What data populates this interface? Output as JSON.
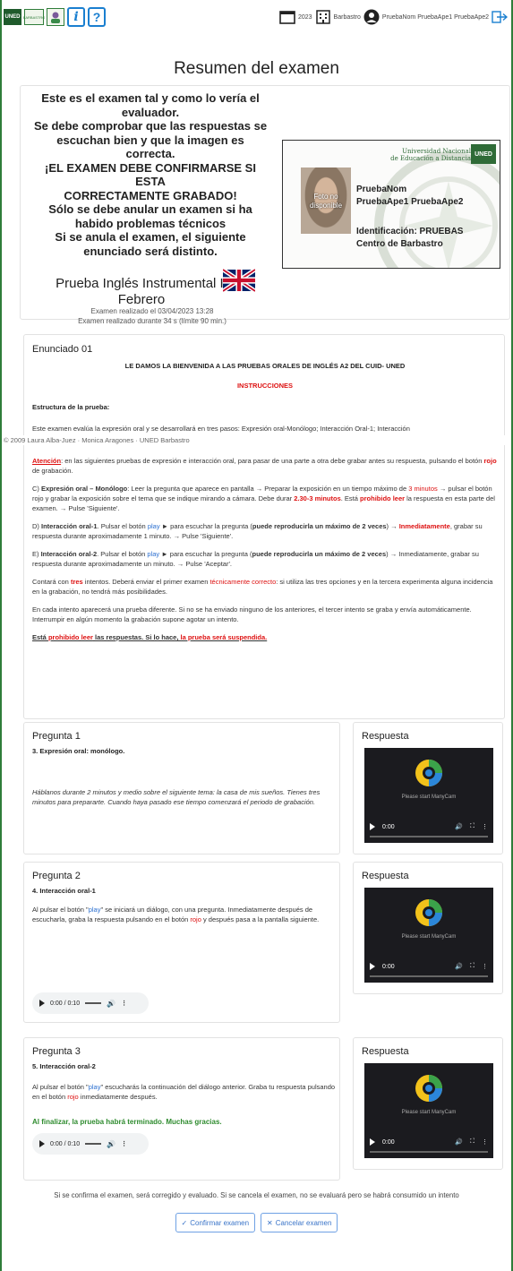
{
  "topbar": {
    "logo_uned": "UNED",
    "logo_barbastro": "BARBASTRO",
    "info_button": "i",
    "help_button": "?",
    "year": "2023",
    "center": "Barbastro",
    "user": "PruebaNom PruebaApe1 PruebaApe2"
  },
  "page": {
    "title": "Resumen del examen"
  },
  "summary": {
    "message_lines": [
      "Este es el examen tal y como lo vería el",
      "evaluador.",
      "Se debe comprobar que las respuestas se",
      "escuchan bien y que la imagen es",
      "correcta.",
      "¡EL EXAMEN DEBE CONFIRMARSE SI ESTA",
      "CORRECTAMENTE GRABADO!",
      "Sólo se debe anular un examen si ha",
      "habido problemas técnicos",
      "Si se anula el examen, el siguiente",
      "enunciado será distinto."
    ],
    "test_name_line1": "Prueba Inglés Instrumental II",
    "test_name_line2": "Febrero",
    "exam_date": "Examen realizado el 03/04/2023 13:28",
    "exam_duration": "Examen realizado durante 34 s (límite 90 min.)"
  },
  "idcard": {
    "university_line1": "Universidad Nacional",
    "university_line2": "de Educación a Distancia",
    "logo": "UNED",
    "photo_text_line1": "Foto no",
    "photo_text_line2": "disponible",
    "name": "PruebaNom",
    "surnames": "PruebaApe1 PruebaApe2",
    "identification": "Identificación: PRUEBAS",
    "center": "Centro de Barbastro"
  },
  "enunciado": {
    "title": "Enunciado 01",
    "welcome": "LE DAMOS LA BIENVENIDA A LAS PRUEBAS ORALES DE INGLÉS A2 DEL CUID- UNED",
    "instructions": "INSTRUCCIONES",
    "structure": "Estructura de la prueba:",
    "evaluation": "Este examen evalúa la expresión oral y se desarrollará en tres pasos:  Expresión oral-Monólogo; Interacción Oral-1; Interacción",
    "copyright": "© 2009 Laura Alba-Juez · Monica Aragones · UNED Barbastro",
    "atencion_label": "Atención",
    "atencion_text1": ": en las siguientes pruebas de expresión e interacción oral, para pasar de una parte a otra debe grabar antes su respuesta, pulsando el botón ",
    "atencion_red": "rojo",
    "atencion_text2": " de grabación.",
    "c_prefix": "C) ",
    "c_title": "Expresión oral – Monólogo",
    "c_text1": ": Leer la pregunta que aparece en pantalla → Preparar la exposición en un tiempo máximo de ",
    "c_time": "3 minutos",
    "c_text2": " → pulsar el botón rojo y grabar la exposición sobre el tema que se indique mirando a cámara. Debe durar ",
    "c_duration": "2.30-3 minutos",
    "c_text3": ". Está ",
    "c_prohibido": "prohibido leer",
    "c_text4": " la respuesta en esta parte del examen. → Pulse 'Siguiente'.",
    "d_prefix": "D) ",
    "d_title": "Interacción oral-1",
    "d_text1": ". Pulsar el botón ",
    "d_play": "play",
    "d_text2": " ► para escuchar la pregunta (",
    "d_bold": "puede reproducirla un máximo de 2 veces",
    "d_text3": ") → ",
    "d_inmediatamente": "Inmediatamente",
    "d_text4": ", grabar su respuesta durante aproximadamente 1 minuto. → Pulse 'Siguiente'.",
    "e_prefix": "E) ",
    "e_title": "Interacción oral-2",
    "e_text1": ". Pulsar el botón ",
    "e_play": "play",
    "e_text2": " ► para escuchar la pregunta (",
    "e_bold": "puede reproducirla un máximo de 2 veces",
    "e_text3": ")  → Inmediatamente, grabar su respuesta durante aproximadamente un minuto. → Pulse 'Aceptar'.",
    "intentos_text1": "Contará con ",
    "intentos_tres": "tres",
    "intentos_text2": " intentos.  Deberá enviar el primer examen ",
    "intentos_tecn": "técnicamente correcto",
    "intentos_text3": ": si utiliza las tres opciones y en la tercera experimenta alguna incidencia en la grabación, no tendrá más posibilidades.",
    "cada_intento": "En cada intento aparecerá una prueba diferente. Si no se ha enviado ninguno de los anteriores, el tercer intento se graba y envía automáticamente. Interrumpir en algún momento la grabación supone agotar un intento.",
    "final_text1": "Está ",
    "final_prohibido": "prohibido leer",
    "final_text2": " las respuestas. Si lo hace, ",
    "final_suspendida": "la prueba será suspendida."
  },
  "questions": [
    {
      "title": "Pregunta 1",
      "subtitle": "3. Expresión oral: monólogo.",
      "text": "Háblanos durante 2 minutos y medio sobre el siguiente tema: la casa de mis sueños. Tienes tres minutos para prepararte. Cuando haya pasado ese tiempo comenzará el periodo de grabación."
    },
    {
      "title": "Pregunta 2",
      "subtitle": "4. Interacción oral-1",
      "text1": "Al pulsar el botón \"",
      "play": "play",
      "text2": "\" se iniciará un diálogo, con una pregunta. Inmediatamente después de escucharla, graba la respuesta pulsando en el botón ",
      "rojo": "rojo",
      "text3": " y después pasa a la pantalla siguiente.",
      "audio_time": "0:00 / 0:10"
    },
    {
      "title": "Pregunta 3",
      "subtitle": "5. Interacción oral-2",
      "text1": "Al pulsar el botón \"",
      "play": "play",
      "text2": "\" escucharás la continuación del diálogo anterior. Graba tu respuesta pulsando en el botón ",
      "rojo": "rojo",
      "text3": " inmediatamente después.",
      "final": "Al finalizar, la prueba habrá terminado. Muchas gracias.",
      "audio_time": "0:00 / 0:10"
    }
  ],
  "responses": {
    "title": "Respuesta",
    "video_message": "Please start ManyCam",
    "video_time": "0:00"
  },
  "footer": {
    "note": "Si se confirma el examen, será corregido y evaluado. Si se cancela el examen, no se evaluará pero se habrá consumido un intento",
    "confirm": "Confirmar examen",
    "cancel": "Cancelar examen"
  },
  "colors": {
    "accent": "#1a7fd0",
    "brand_green": "#2f7d3a",
    "warning_red": "#dd1111",
    "success_green": "#2e8b2e"
  }
}
